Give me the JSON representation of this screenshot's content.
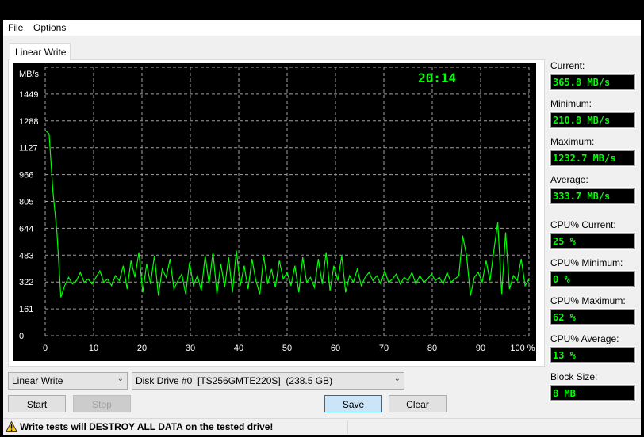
{
  "menu": {
    "file": "File",
    "options": "Options"
  },
  "tab": {
    "label": "Linear Write"
  },
  "chart_data": {
    "type": "line",
    "ylabel": "MB/s",
    "xlabel": "",
    "ylim": [
      0,
      1610
    ],
    "xlim": [
      0,
      100
    ],
    "y_ticks": [
      "0",
      "161",
      "322",
      "483",
      "644",
      "805",
      "966",
      "1127",
      "1288",
      "1449"
    ],
    "y_tick_values": [
      0,
      161,
      322,
      483,
      644,
      805,
      966,
      1127,
      1288,
      1449
    ],
    "x_ticks": [
      "0",
      "10",
      "20",
      "30",
      "40",
      "50",
      "60",
      "70",
      "80",
      "90",
      "100 %"
    ],
    "x_tick_values": [
      0,
      10,
      20,
      30,
      40,
      50,
      60,
      70,
      80,
      90,
      100
    ],
    "grid": true,
    "timer": "20:14",
    "colors": {
      "line": "#00ff00",
      "grid": "#a0a0a0",
      "background": "#000000"
    },
    "series": [
      {
        "values": [
          1232,
          1210,
          860,
          620,
          230,
          300,
          350,
          310,
          330,
          380,
          320,
          340,
          310,
          350,
          390,
          320,
          340,
          300,
          360,
          330,
          420,
          280,
          450,
          350,
          500,
          260,
          430,
          310,
          480,
          240,
          400,
          350,
          460,
          280,
          330,
          370,
          250,
          440,
          300,
          360,
          270,
          480,
          310,
          500,
          250,
          430,
          290,
          470,
          260,
          510,
          300,
          420,
          280,
          460,
          330,
          250,
          480,
          310,
          400,
          290,
          450,
          340,
          380,
          300,
          420,
          260,
          470,
          320,
          350,
          290,
          460,
          310,
          500,
          270,
          420,
          330,
          480,
          260,
          360,
          320,
          400,
          300,
          350,
          380,
          330,
          360,
          310,
          390,
          320,
          340,
          370,
          310,
          350,
          330,
          380,
          310,
          360,
          320,
          340,
          370,
          330,
          350,
          310,
          380,
          320,
          340,
          360,
          600,
          480,
          240,
          350,
          380,
          320,
          450,
          330,
          510,
          680,
          250,
          620,
          280,
          360,
          330,
          460,
          300,
          340
        ]
      }
    ]
  },
  "stats": [
    {
      "label": "Current:",
      "value": "365.8 MB/s"
    },
    {
      "label": "Minimum:",
      "value": "210.8 MB/s"
    },
    {
      "label": "Maximum:",
      "value": "1232.7 MB/s"
    },
    {
      "label": "Average:",
      "value": "333.7 MB/s"
    },
    {
      "label": "CPU% Current:",
      "value": "25 %"
    },
    {
      "label": "CPU% Minimum:",
      "value": "0 %"
    },
    {
      "label": "CPU% Maximum:",
      "value": "62 %"
    },
    {
      "label": "CPU% Average:",
      "value": "13 %"
    },
    {
      "label": "Block Size:",
      "value": "8 MB"
    }
  ],
  "controls": {
    "test_type": "Linear Write",
    "drive": "Disk Drive #0  [TS256GMTE220S]  (238.5 GB)",
    "start": "Start",
    "stop": "Stop",
    "save": "Save",
    "clear": "Clear"
  },
  "status": {
    "icon": "warning-icon",
    "message": "Write tests will DESTROY ALL DATA on the tested drive!"
  }
}
